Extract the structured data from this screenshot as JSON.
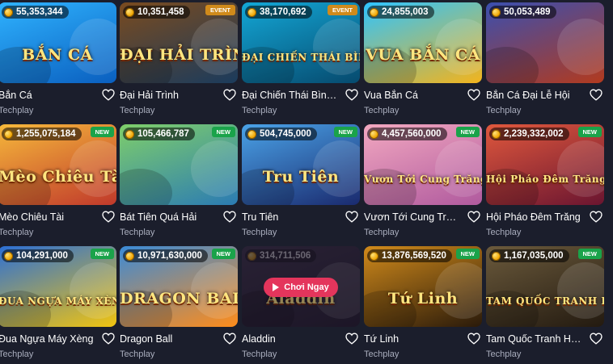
{
  "games": [
    {
      "title": "Bắn Cá",
      "provider": "Techplay",
      "jackpot": "55,353,344",
      "badge": "",
      "art": "BẮN CÁ",
      "colors": [
        "#2fb3ff",
        "#0a5fbf"
      ]
    },
    {
      "title": "Đại Hải Trình",
      "provider": "Techplay",
      "jackpot": "10,351,458",
      "badge": "EVENT",
      "art": "ĐẠI HẢI TRÌNH",
      "colors": [
        "#7a4b1f",
        "#1b3b5c"
      ]
    },
    {
      "title": "Đại Chiến Thái Bình...",
      "provider": "Techplay",
      "jackpot": "38,170,692",
      "badge": "EVENT",
      "art": "ĐẠI CHIẾN THÁI BÌNH DƯƠNG",
      "colors": [
        "#13a7d6",
        "#064a6e"
      ]
    },
    {
      "title": "Vua Bắn Cá",
      "provider": "Techplay",
      "jackpot": "24,855,003",
      "badge": "",
      "art": "VUA BẮN CÁ",
      "colors": [
        "#2ec4ff",
        "#f3b41c"
      ]
    },
    {
      "title": "Bắn Cá Đại Lễ Hội",
      "provider": "Techplay",
      "jackpot": "50,053,489",
      "badge": "",
      "art": "",
      "colors": [
        "#3a4fb0",
        "#b23a1e"
      ]
    },
    {
      "title": "Mèo Chiêu Tài",
      "provider": "Techplay",
      "jackpot": "1,255,075,184",
      "badge": "NEW",
      "art": "Mèo Chiêu Tài",
      "colors": [
        "#f6b93b",
        "#c0392b"
      ]
    },
    {
      "title": "Bát Tiên Quá Hải",
      "provider": "Techplay",
      "jackpot": "105,466,787",
      "badge": "NEW",
      "art": "",
      "colors": [
        "#7fcf6a",
        "#2b7bb3"
      ]
    },
    {
      "title": "Tru Tiên",
      "provider": "Techplay",
      "jackpot": "504,745,000",
      "badge": "NEW",
      "art": "Tru Tiên",
      "colors": [
        "#4aa3e8",
        "#1a2a6e"
      ]
    },
    {
      "title": "Vươn Tới Cung Trăng",
      "provider": "Techplay",
      "jackpot": "4,457,560,000",
      "badge": "NEW",
      "art": "Vươn Tới Cung Trăng",
      "colors": [
        "#f2a8c0",
        "#b05a9e"
      ]
    },
    {
      "title": "Hội Pháo Đêm Trăng",
      "provider": "Techplay",
      "jackpot": "2,239,332,002",
      "badge": "NEW",
      "art": "Hội Pháo Đêm Trăng",
      "colors": [
        "#e0583d",
        "#6a1530"
      ]
    },
    {
      "title": "Đua Ngựa Máy Xèng",
      "provider": "Techplay",
      "jackpot": "104,291,000",
      "badge": "NEW",
      "art": "ĐUA NGỰA MÁY XÈNG",
      "colors": [
        "#2b6fd6",
        "#f1c40f"
      ]
    },
    {
      "title": "Dragon Ball",
      "provider": "Techplay",
      "jackpot": "10,971,630,000",
      "badge": "NEW",
      "art": "DRAGON BALL",
      "colors": [
        "#3a8bd8",
        "#ff8c1a"
      ]
    },
    {
      "title": "Aladdin",
      "provider": "Techplay",
      "jackpot": "314,711,506",
      "badge": "",
      "art": "Aladdin",
      "colors": [
        "#3b3147",
        "#241c2e"
      ],
      "hover": true
    },
    {
      "title": "Tứ Linh",
      "provider": "Techplay",
      "jackpot": "13,876,569,520",
      "badge": "NEW",
      "art": "Tứ Linh",
      "colors": [
        "#d08a1b",
        "#2a1a0a"
      ]
    },
    {
      "title": "Tam Quốc Tranh Hùng",
      "provider": "Techplay",
      "jackpot": "1,167,035,000",
      "badge": "NEW",
      "art": "TAM QUỐC TRANH HÙNG",
      "colors": [
        "#6b5a3c",
        "#231a10"
      ]
    }
  ],
  "play_label": "Chơi Ngay",
  "icons": {
    "heart": "heart-icon",
    "coin": "coin-icon",
    "play": "play-icon"
  }
}
